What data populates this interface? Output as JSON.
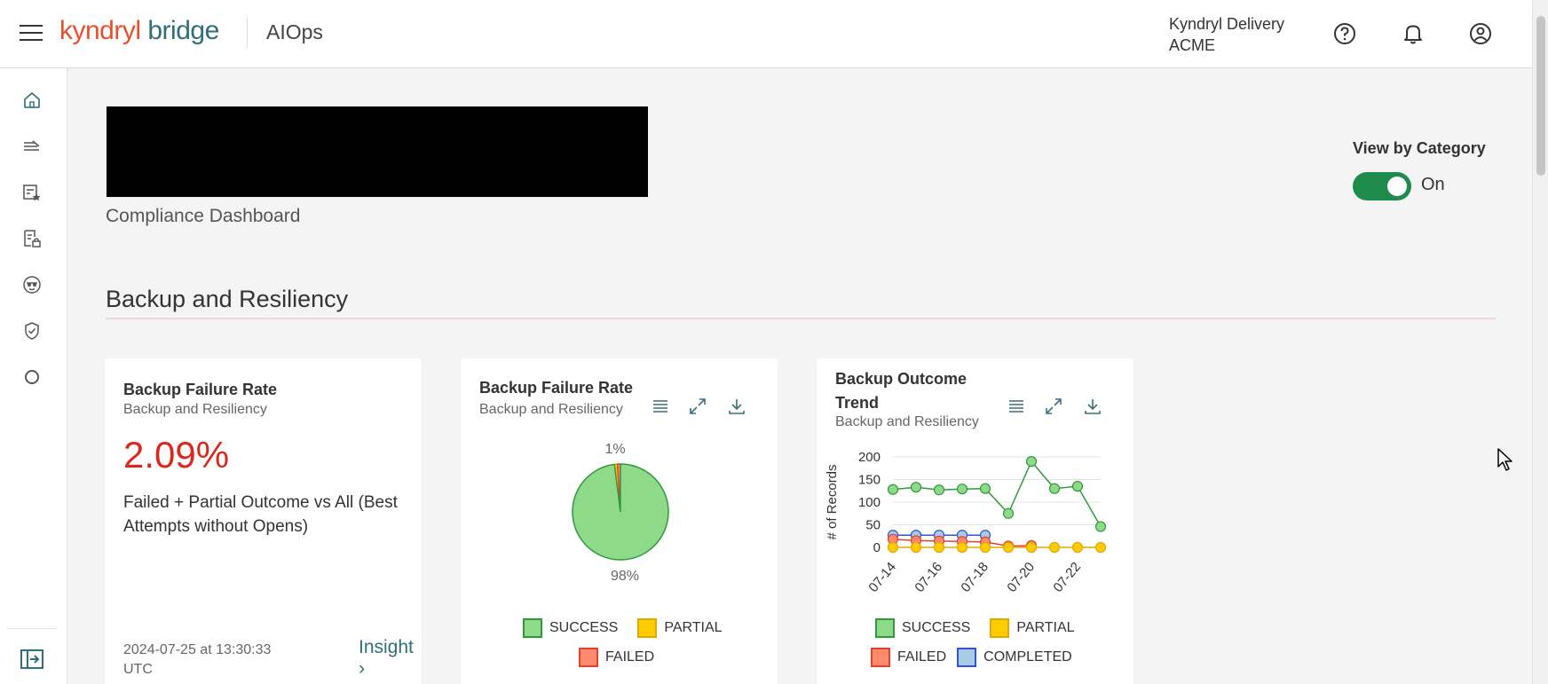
{
  "header": {
    "logo_kyndryl": "kyndryl",
    "logo_bridge": "bridge",
    "app_name": "AIOps",
    "delivery_line1": "Kyndryl Delivery",
    "delivery_line2": "ACME"
  },
  "rail": {
    "icons": [
      "home-icon",
      "tasks-icon",
      "starred-list-icon",
      "secure-doc-icon",
      "incognito-icon",
      "shield-check-icon",
      "circle-icon"
    ],
    "collapse_icon": "expand-panel-icon"
  },
  "page": {
    "subtitle": "Compliance Dashboard",
    "view_by_category_label": "View by Category",
    "toggle_state": "On",
    "section_title": "Backup and Resiliency"
  },
  "cards": [
    {
      "title": "Backup Failure Rate",
      "subtitle": "Backup and Resiliency",
      "value": "2.09%",
      "desc": "Failed + Partial Outcome vs All (Best Attempts without Opens)",
      "timestamp": "2024-07-25 at 13:30:33 UTC",
      "insight_label": "Insight",
      "insight_chevron": "›"
    },
    {
      "title": "Backup Failure Rate",
      "subtitle": "Backup and Resiliency",
      "legend": [
        "SUCCESS",
        "PARTIAL",
        "FAILED"
      ]
    },
    {
      "title_line1": "Backup Outcome",
      "title_line2": "Trend",
      "subtitle": "Backup and Resiliency",
      "legend": [
        "SUCCESS",
        "PARTIAL",
        "FAILED",
        "COMPLETED"
      ]
    }
  ],
  "colors": {
    "success": "#8fd98a",
    "success_stroke": "#2f9a3a",
    "partial": "#ffcc00",
    "failed": "#ff8a70",
    "failed_stroke": "#e0432b",
    "completed": "#a9cbe8",
    "completed_stroke": "#3355cc",
    "accent": "#2e6f78",
    "toggle_on": "#1f8b4c"
  },
  "chart_data": [
    {
      "type": "pie",
      "labels": [
        "SUCCESS",
        "PARTIAL",
        "FAILED"
      ],
      "values": [
        98,
        1,
        1
      ],
      "data_labels": [
        "98%",
        "1%"
      ]
    },
    {
      "type": "line",
      "ylabel": "# of Records",
      "ylim": [
        0,
        200
      ],
      "yticks": [
        0,
        50,
        100,
        150,
        200
      ],
      "x": [
        "07-14",
        "07-15",
        "07-16",
        "07-17",
        "07-18",
        "07-19",
        "07-20",
        "07-21",
        "07-22",
        "07-23"
      ],
      "xtick_labels": [
        "07-14",
        "07-16",
        "07-18",
        "07-20",
        "07-22"
      ],
      "series": [
        {
          "name": "SUCCESS",
          "values": [
            128,
            133,
            127,
            129,
            130,
            75,
            190,
            130,
            135,
            46
          ]
        },
        {
          "name": "PARTIAL",
          "values": [
            0,
            0,
            0,
            0,
            0,
            0,
            0,
            0,
            0,
            0
          ]
        },
        {
          "name": "FAILED",
          "values": [
            18,
            15,
            14,
            13,
            12,
            3,
            4,
            null,
            null,
            null
          ]
        },
        {
          "name": "COMPLETED",
          "values": [
            27,
            27,
            27,
            27,
            27,
            null,
            null,
            null,
            null,
            null
          ]
        }
      ],
      "grid": true,
      "legend": "bottom"
    }
  ]
}
